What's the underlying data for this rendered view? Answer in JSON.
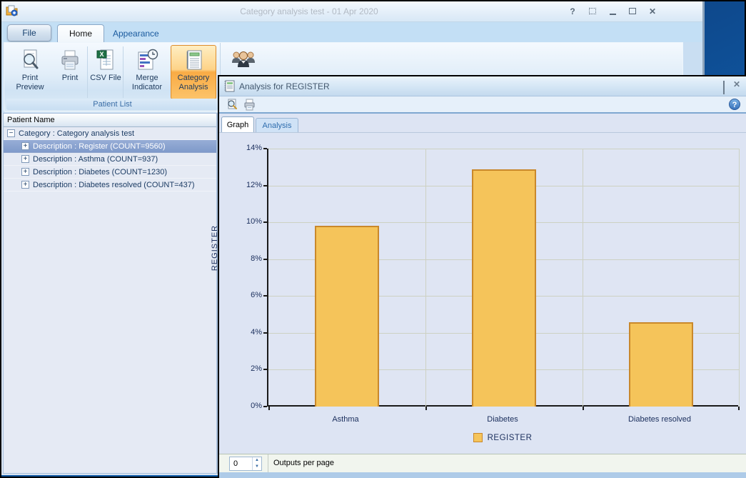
{
  "app": {
    "title": "Category analysis test - 01 Apr 2020",
    "window_controls": {
      "help": "?",
      "close": "✕"
    },
    "tabs": {
      "file": "File",
      "home": "Home",
      "appearance": "Appearance"
    },
    "ribbon": {
      "buttons": {
        "print_preview": "Print Preview",
        "print": "Print",
        "csv_file": "CSV File",
        "merge_indicator": "Merge Indicator",
        "category_analysis": "Category Analysis"
      },
      "group_caption": "Patient List"
    },
    "tree": {
      "header": "Patient Name",
      "root_label": "Category : Category analysis test",
      "expanded_glyph": "−",
      "collapsed_glyph": "+",
      "items": [
        {
          "label": "Description : Register (COUNT=9560)",
          "selected": true
        },
        {
          "label": "Description : Asthma (COUNT=937)",
          "selected": false
        },
        {
          "label": "Description : Diabetes (COUNT=1230)",
          "selected": false
        },
        {
          "label": "Description : Diabetes resolved (COUNT=437)",
          "selected": false
        }
      ]
    }
  },
  "dialog": {
    "title": "Analysis for REGISTER",
    "help_glyph": "?",
    "close_glyph": "✕",
    "tabs": {
      "graph": "Graph",
      "analysis": "Analysis"
    },
    "spinner_value": "0",
    "spinner_label": "Outputs per page"
  },
  "chart_data": {
    "type": "bar",
    "title": "",
    "categories": [
      "Asthma",
      "Diabetes",
      "Diabetes resolved"
    ],
    "values": [
      9.8,
      12.87,
      4.57
    ],
    "series": [
      {
        "name": "REGISTER",
        "values": [
          9.8,
          12.87,
          4.57
        ]
      }
    ],
    "xlabel": "",
    "ylabel": "REGISTER",
    "ylim": [
      0,
      14
    ],
    "ytick_step": 2,
    "ytick_labels": [
      "14%",
      "12%",
      "10%",
      "8%",
      "6%",
      "4%",
      "2%",
      "0%"
    ],
    "legend": [
      "REGISTER"
    ],
    "legend_position": "bottom",
    "grid": true,
    "bar_color": "#F5C45A",
    "bar_border_color": "#C9882B",
    "plot_bg": "#DFE5F3",
    "gridline_color": "#CDD1C2"
  }
}
